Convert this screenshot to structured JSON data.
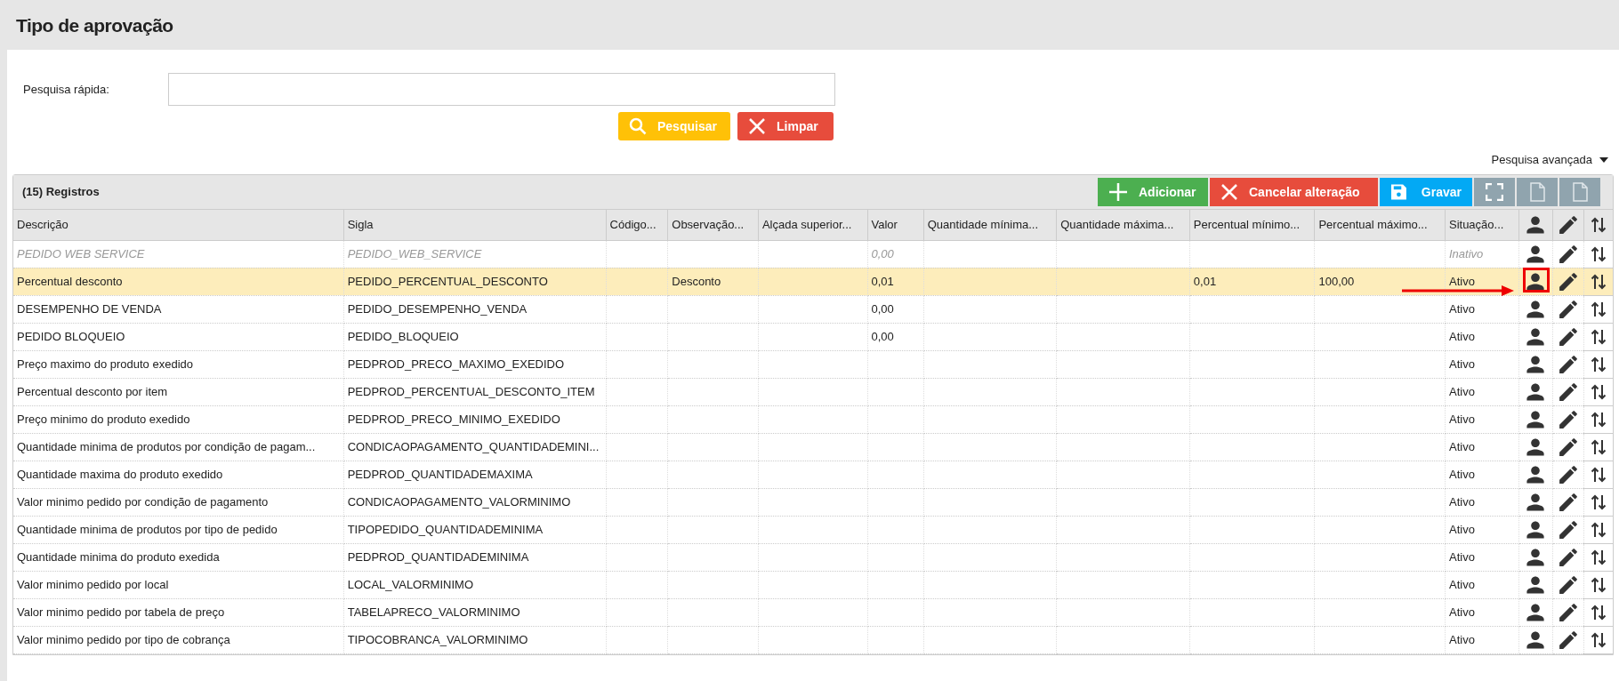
{
  "page_title": "Tipo de aprovação",
  "quick_search": {
    "label": "Pesquisa rápida:",
    "buttons": [
      {
        "kind": "search",
        "label": "Pesquisar"
      },
      {
        "kind": "clear",
        "label": "Limpar"
      }
    ]
  },
  "advanced_search": {
    "label": "Pesquisa avançada",
    "expanded": false
  },
  "grid": {
    "record_count": "(15) Registros",
    "toolbar": [
      {
        "kind": "add",
        "label": "Adicionar"
      },
      {
        "kind": "cancel",
        "label": "Cancelar alteração"
      },
      {
        "kind": "save",
        "label": "Gravar"
      },
      {
        "kind": "fullscreen"
      },
      {
        "kind": "csv"
      },
      {
        "kind": "xls"
      }
    ],
    "columns": [
      {
        "label": "Descrição"
      },
      {
        "label": "Sigla"
      },
      {
        "label": "Código..."
      },
      {
        "label": "Observação..."
      },
      {
        "label": "Alçada superior..."
      },
      {
        "label": "Valor"
      },
      {
        "label": "Quantidade mínima..."
      },
      {
        "label": "Quantidade máxima..."
      },
      {
        "label": "Percentual mínimo..."
      },
      {
        "label": "Percentual máximo..."
      },
      {
        "label": "Situação..."
      }
    ],
    "rows": [
      {
        "selected": false,
        "inactive": true,
        "marked": false,
        "cells": {
          "descricao": "PEDIDO WEB SERVICE",
          "sigla": "PEDIDO_WEB_SERVICE",
          "valor": "0,00",
          "situacao": "Inativo"
        }
      },
      {
        "selected": true,
        "inactive": false,
        "marked": true,
        "cells": {
          "descricao": "Percentual desconto",
          "sigla": "PEDIDO_PERCENTUAL_DESCONTO",
          "observacao": "Desconto",
          "valor": "0,01",
          "perc_min": "0,01",
          "perc_max": "100,00",
          "situacao": "Ativo"
        }
      },
      {
        "selected": false,
        "inactive": false,
        "marked": false,
        "cells": {
          "descricao": "DESEMPENHO DE VENDA",
          "sigla": "PEDIDO_DESEMPENHO_VENDA",
          "valor": "0,00",
          "situacao": "Ativo"
        }
      },
      {
        "selected": false,
        "inactive": false,
        "marked": false,
        "cells": {
          "descricao": "PEDIDO BLOQUEIO",
          "sigla": "PEDIDO_BLOQUEIO",
          "valor": "0,00",
          "situacao": "Ativo"
        }
      },
      {
        "selected": false,
        "inactive": false,
        "marked": false,
        "cells": {
          "descricao": "Preço maximo do produto exedido",
          "sigla": "PEDPROD_PRECO_MAXIMO_EXEDIDO",
          "situacao": "Ativo"
        }
      },
      {
        "selected": false,
        "inactive": false,
        "marked": false,
        "cells": {
          "descricao": "Percentual desconto por item",
          "sigla": "PEDPROD_PERCENTUAL_DESCONTO_ITEM",
          "situacao": "Ativo"
        }
      },
      {
        "selected": false,
        "inactive": false,
        "marked": false,
        "cells": {
          "descricao": "Preço minimo do produto exedido",
          "sigla": "PEDPROD_PRECO_MINIMO_EXEDIDO",
          "situacao": "Ativo"
        }
      },
      {
        "selected": false,
        "inactive": false,
        "marked": false,
        "cells": {
          "descricao": "Quantidade minima de produtos por condição de pagam...",
          "sigla": "CONDICAOPAGAMENTO_QUANTIDADEMINI...",
          "situacao": "Ativo"
        }
      },
      {
        "selected": false,
        "inactive": false,
        "marked": false,
        "cells": {
          "descricao": "Quantidade maxima do produto exedido",
          "sigla": "PEDPROD_QUANTIDADEMAXIMA",
          "situacao": "Ativo"
        }
      },
      {
        "selected": false,
        "inactive": false,
        "marked": false,
        "cells": {
          "descricao": "Valor minimo pedido por condição de pagamento",
          "sigla": "CONDICAOPAGAMENTO_VALORMINIMO",
          "situacao": "Ativo"
        }
      },
      {
        "selected": false,
        "inactive": false,
        "marked": false,
        "cells": {
          "descricao": "Quantidade minima de produtos por tipo de pedido",
          "sigla": "TIPOPEDIDO_QUANTIDADEMINIMA",
          "situacao": "Ativo"
        }
      },
      {
        "selected": false,
        "inactive": false,
        "marked": false,
        "cells": {
          "descricao": "Quantidade minima do produto exedida",
          "sigla": "PEDPROD_QUANTIDADEMINIMA",
          "situacao": "Ativo"
        }
      },
      {
        "selected": false,
        "inactive": false,
        "marked": false,
        "cells": {
          "descricao": "Valor minimo pedido por local",
          "sigla": "LOCAL_VALORMINIMO",
          "situacao": "Ativo"
        }
      },
      {
        "selected": false,
        "inactive": false,
        "marked": false,
        "cells": {
          "descricao": "Valor minimo pedido por tabela de preço",
          "sigla": "TABELAPRECO_VALORMINIMO",
          "situacao": "Ativo"
        }
      },
      {
        "selected": false,
        "inactive": false,
        "marked": false,
        "cells": {
          "descricao": "Valor minimo pedido por tipo de cobrança",
          "sigla": "TIPOCOBRANCA_VALORMINIMO",
          "situacao": "Ativo"
        }
      }
    ]
  }
}
